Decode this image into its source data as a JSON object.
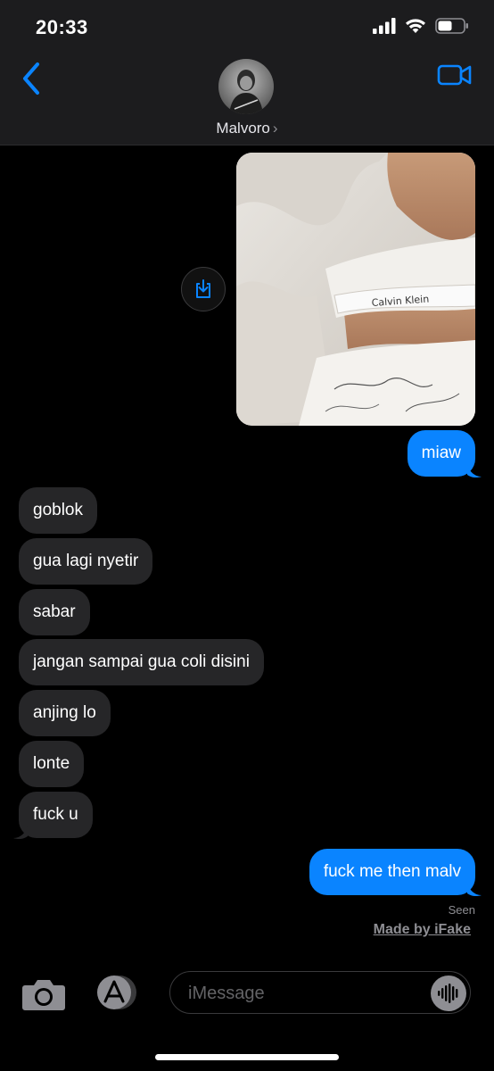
{
  "status": {
    "time": "20:33"
  },
  "header": {
    "contact_name": "Malvoro",
    "chevron": "›"
  },
  "messages": [
    {
      "type": "image",
      "from": "me",
      "caption": "Calvin Klein"
    },
    {
      "type": "text",
      "from": "me",
      "text": "miaw"
    },
    {
      "type": "text",
      "from": "them",
      "text": "goblok"
    },
    {
      "type": "text",
      "from": "them",
      "text": "gua lagi nyetir"
    },
    {
      "type": "text",
      "from": "them",
      "text": "sabar"
    },
    {
      "type": "text",
      "from": "them",
      "text": "jangan sampai gua coli disini"
    },
    {
      "type": "text",
      "from": "them",
      "text": "anjing lo"
    },
    {
      "type": "text",
      "from": "them",
      "text": "lonte"
    },
    {
      "type": "text",
      "from": "them",
      "text": "fuck u"
    },
    {
      "type": "text",
      "from": "me",
      "text": "fuck me then malv"
    }
  ],
  "receipt": {
    "status": "Seen",
    "watermark": "Made by iFake"
  },
  "composer": {
    "placeholder": "iMessage"
  },
  "icons": {
    "back": "chevron-left-icon",
    "video": "video-camera-icon",
    "download": "download-icon",
    "camera": "camera-icon",
    "apps": "app-store-icon",
    "audio": "audio-waveform-icon"
  },
  "colors": {
    "accent": "#0a84ff",
    "received_bubble": "#262628",
    "bar_bg": "#1c1c1e"
  }
}
